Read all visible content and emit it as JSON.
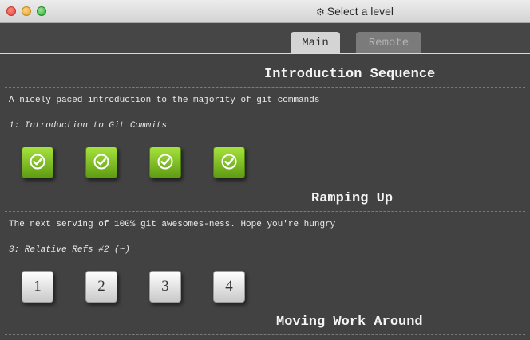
{
  "window": {
    "title": "Select a level",
    "title_icon": "gear-icon"
  },
  "tabs": [
    {
      "label": "Main",
      "active": true
    },
    {
      "label": "Remote",
      "active": false
    }
  ],
  "sections": [
    {
      "title": "Introduction Sequence",
      "description": "A nicely paced introduction to the majority of git commands",
      "current_level": "1: Introduction to Git Commits",
      "levels": [
        "completed",
        "completed",
        "completed",
        "completed"
      ]
    },
    {
      "title": "Ramping Up",
      "description": "The next serving of 100% git awesomes-ness. Hope you're hungry",
      "current_level": "3: Relative Refs #2 (~)",
      "levels": [
        "1",
        "2",
        "3",
        "4"
      ]
    },
    {
      "title": "Moving Work Around"
    }
  ],
  "colors": {
    "background": "#424242",
    "completed_green": "#7cc224",
    "tab_active": "#d4d4d4",
    "tab_inactive": "#7b7b7b"
  }
}
